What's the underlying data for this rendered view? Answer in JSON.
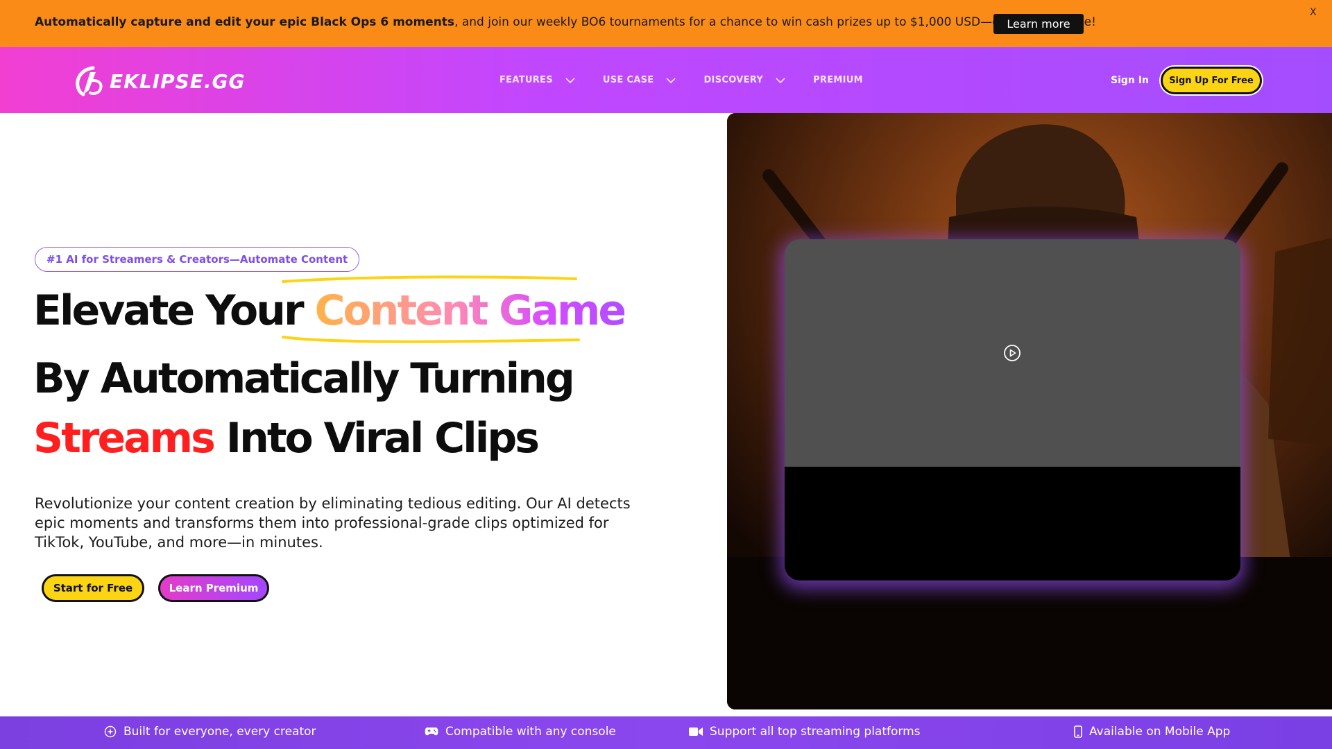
{
  "promo": {
    "bold_text": "Automatically capture and edit your epic Black Ops 6 moments",
    "rest_text": ", and join our weekly BO6 tournaments for a chance to win cash prizes up to $1,000 USD—only with Eklipse!",
    "button_label": "Learn more",
    "close_label": "X"
  },
  "header": {
    "logo_text": "EKLIPSE.GG",
    "nav": [
      {
        "label": "FEATURES",
        "has_dropdown": true
      },
      {
        "label": "USE CASE",
        "has_dropdown": true
      },
      {
        "label": "DISCOVERY",
        "has_dropdown": true
      },
      {
        "label": "PREMIUM",
        "has_dropdown": false
      }
    ],
    "signin_label": "Sign In",
    "signup_label": "Sign Up For Free"
  },
  "hero": {
    "tagline": "#1 AI for Streamers & Creators—Automate Content",
    "headline_line1_a": "Elevate Your ",
    "headline_line1_highlight": "Content Game",
    "headline_line2": "By Automatically Turning",
    "headline_line3_highlight": "Streams",
    "headline_line3_b": " Into Viral Clips",
    "description": "Revolutionize your content creation by eliminating tedious editing. Our AI detects epic moments and transforms them into professional-grade clips optimized for TikTok, YouTube, and more—in minutes.",
    "cta_primary": "Start for Free",
    "cta_secondary": "Learn Premium"
  },
  "features": [
    {
      "icon": "sparkle-icon",
      "label": "Built for everyone, every creator"
    },
    {
      "icon": "gamepad-icon",
      "label": "Compatible with any console"
    },
    {
      "icon": "video-camera-icon",
      "label": "Support all top streaming platforms"
    },
    {
      "icon": "mobile-phone-icon",
      "label": "Available on Mobile App"
    }
  ],
  "colors": {
    "promo_bg": "#fb8b17",
    "header_gradient_start": "#f23fd2",
    "header_gradient_end": "#a44dff",
    "cta_yellow": "#fbd414",
    "headline_red": "#ff1f1f",
    "tagline_purple": "#7d4ee8",
    "feature_strip": "#8b47ee"
  }
}
